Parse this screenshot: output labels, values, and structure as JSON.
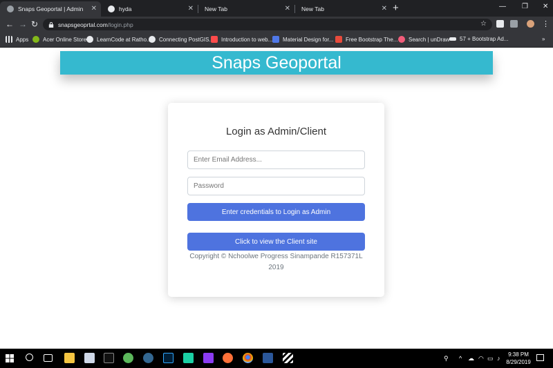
{
  "tabs": [
    {
      "label": "Snaps Geoportal | Admin",
      "active": true
    },
    {
      "label": "hyda",
      "active": false
    },
    {
      "label": "New Tab",
      "active": false
    },
    {
      "label": "New Tab",
      "active": false
    }
  ],
  "toolbar": {
    "url_host": "snapsgeoprtal.com",
    "url_path": "/login.php"
  },
  "bookmarks": [
    {
      "label": "Apps",
      "icon": "apps-grid-icon",
      "color": "#e8eaed"
    },
    {
      "label": "Acer Online Store",
      "icon": "acer-icon",
      "color": "#83b81a"
    },
    {
      "label": "LearnCode at Ratho...",
      "icon": "globe-icon",
      "color": "#e8eaed"
    },
    {
      "label": "Connecting PostGIS...",
      "icon": "wordpress-icon",
      "color": "#e8eaed"
    },
    {
      "label": "Introduction to web...",
      "icon": "web-icon",
      "color": "#ff4b4b"
    },
    {
      "label": "Material Design for...",
      "icon": "mdb-icon",
      "color": "#4f78e8"
    },
    {
      "label": "Free Bootstrap The...",
      "icon": "s-icon",
      "color": "#e84b3c"
    },
    {
      "label": "Search | unDraw",
      "icon": "undraw-icon",
      "color": "#f25c7a"
    },
    {
      "label": "57 + Bootstrap Ad...",
      "icon": "bow-icon",
      "color": "#e8eaed"
    }
  ],
  "page": {
    "banner_title": "Snaps Geoportal",
    "login_heading": "Login as Admin/Client",
    "email_placeholder": "Enter Email Address...",
    "password_placeholder": "Password",
    "admin_button": "Enter credentials to Login as Admin",
    "client_button": "Click to view the Client site",
    "copyright_line1": "Copyright © Nchoolwe Progress Sinampande R157371L",
    "copyright_line2": "2019"
  },
  "colors": {
    "banner": "#35b9cf",
    "button": "#4e73df"
  },
  "taskbar": {
    "time": "9:38 PM",
    "date": "8/29/2019"
  }
}
